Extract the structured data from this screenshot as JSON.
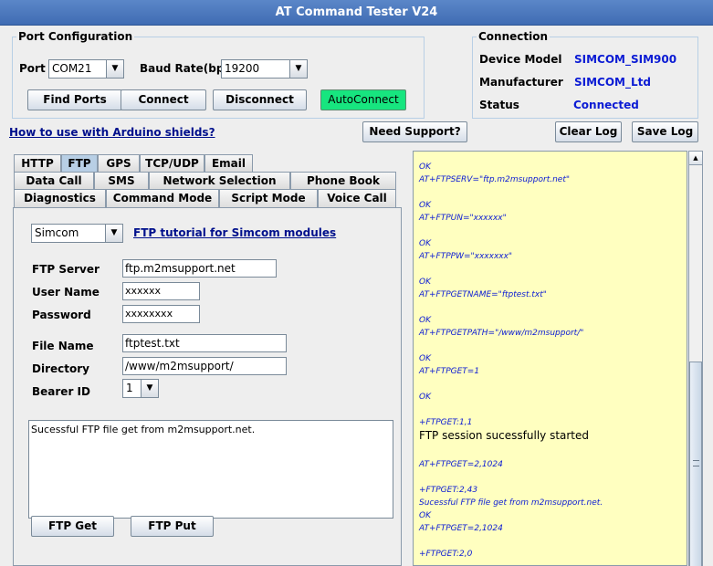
{
  "window": {
    "title": "AT Command Tester V24"
  },
  "port_config": {
    "legend": "Port Configuration",
    "port_label": "Port",
    "port_value": "COM21",
    "baud_label": "Baud Rate(bps)",
    "baud_value": "19200",
    "find_ports": "Find Ports",
    "connect": "Connect",
    "disconnect": "Disconnect",
    "autoconnect": "AutoConnect"
  },
  "connection": {
    "legend": "Connection",
    "device_model_label": "Device Model",
    "device_model_value": "SIMCOM_SIM900",
    "manufacturer_label": "Manufacturer",
    "manufacturer_value": "SIMCOM_Ltd",
    "status_label": "Status",
    "status_value": "Connected"
  },
  "toolbar": {
    "arduino_link": "How to use with Arduino shields?",
    "need_support": "Need Support?",
    "clear_log": "Clear Log",
    "save_log": "Save Log"
  },
  "tabs": {
    "row3": [
      "HTTP",
      "FTP",
      "GPS",
      "TCP/UDP",
      "Email"
    ],
    "row2": [
      "Data Call",
      "SMS",
      "Network Selection",
      "Phone Book"
    ],
    "row1": [
      "Diagnostics",
      "Command Mode",
      "Script Mode",
      "Voice Call"
    ],
    "active": "FTP"
  },
  "ftp": {
    "module_value": "Simcom",
    "tutorial_link": "FTP tutorial for Simcom modules",
    "server_label": "FTP Server",
    "server_value": "ftp.m2msupport.net",
    "user_label": "User Name",
    "user_value": "xxxxxx",
    "password_label": "Password",
    "password_value": "xxxxxxxx",
    "file_label": "File Name",
    "file_value": "ftptest.txt",
    "directory_label": "Directory",
    "directory_value": "/www/m2msupport/",
    "bearer_label": "Bearer ID",
    "bearer_value": "1",
    "status_text": "Sucessful FTP file get from m2msupport.net.",
    "get_button": "FTP Get",
    "put_button": "FTP Put"
  },
  "log": [
    "OK",
    "AT+FTPSERV=\"ftp.m2msupport.net\"",
    "OK",
    "AT+FTPUN=\"xxxxxx\"",
    "OK",
    "AT+FTPPW=\"xxxxxxx\"",
    "OK",
    "AT+FTPGETNAME=\"ftptest.txt\"",
    "OK",
    "AT+FTPGETPATH=\"/www/m2msupport/\"",
    "OK",
    "AT+FTPGET=1",
    "OK",
    "+FTPGET:1,1",
    "FTP session sucessfully started",
    "AT+FTPGET=2,1024",
    "+FTPGET:2,43",
    "Sucessful FTP file get from m2msupport.net.",
    "OK",
    "AT+FTPGET=2,1024",
    "+FTPGET:2,0"
  ],
  "icons": {
    "dropdown": "chevron-down-icon",
    "scroll_up": "arrow-up-icon"
  },
  "colors": {
    "title_bar": "#4a78bf",
    "autoconnect": "#17e57f",
    "link": "#00108c",
    "connection_values": "#0b1bd4",
    "log_background": "#ffffc0"
  }
}
